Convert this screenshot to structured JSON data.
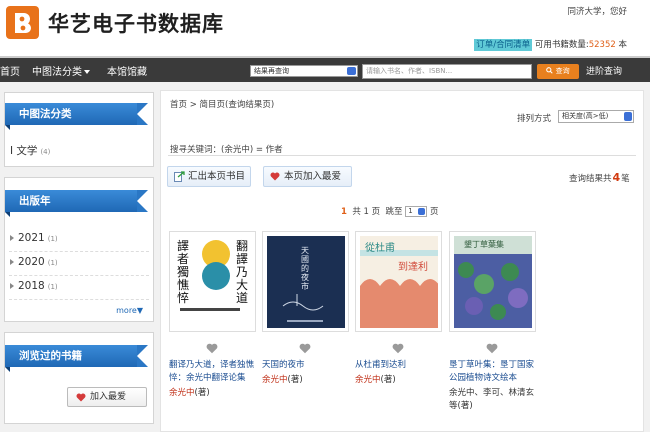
{
  "header": {
    "site_title": "华艺电子书数据库",
    "welcome": "同济大学，您好",
    "order_link": "订单/合同清单",
    "available_label": "可用书籍数量:",
    "available_count": "52352",
    "available_unit": "本"
  },
  "nav": {
    "home": "首页",
    "clc": "中图法分类",
    "collection": "本馆馆藏",
    "scope_value": "结果再查询",
    "search_placeholder": "请输入书名、作者、ISBN...",
    "search_button": "查询",
    "advanced": "进阶查询"
  },
  "sidebar": {
    "clc_title": "中图法分类",
    "clc_items": [
      {
        "label": "I 文学",
        "count": "(4)"
      }
    ],
    "pub_title": "出版年",
    "pub_items": [
      {
        "label": "2021",
        "count": "(1)"
      },
      {
        "label": "2020",
        "count": "(1)"
      },
      {
        "label": "2018",
        "count": "(1)"
      }
    ],
    "more": "more▼",
    "history_title": "浏览过的书籍",
    "add_fav": "加入最爱"
  },
  "main": {
    "breadcrumb": "首页 > 简目页(查询结果页)",
    "sort_label": "排列方式",
    "sort_value": "相关度(高>低)",
    "keyword_line": "搜寻关键词：(余光中) = 作者",
    "export_button": "汇出本页书目",
    "add_page_fav": "本页加入最爱",
    "result_prefix": "查询结果共",
    "result_count": "4",
    "result_suffix": "笔",
    "pager": {
      "current": "1",
      "total_text": "共 1 页",
      "jump_label": "跳至",
      "jump_value": "1",
      "page_unit": "页"
    }
  },
  "books": [
    {
      "title": "翻译乃大道，译者独憔悴：余光中翻译论集",
      "author": "余光中",
      "role": "(著)",
      "cover_text_a": "譯者獨憔悴",
      "cover_text_b": "翻譯乃大道"
    },
    {
      "title": "天国的夜市",
      "author": "余光中",
      "role": "(著)",
      "cover_text_a": "天國的夜市"
    },
    {
      "title": "从杜甫到达利",
      "author": "余光中",
      "role": "(著)",
      "cover_text_a": "從杜甫",
      "cover_text_b": "到達利"
    },
    {
      "title": "垦丁草叶集：垦丁国家公园植物诗文绘本",
      "author": "余光中",
      "role": "、李可、林清玄等(著)",
      "cover_text_a": "墾丁草葉集"
    }
  ],
  "colors": {
    "accent": "#e8801e",
    "nav_bg": "#3a3a3a",
    "ribbon": "#1f68b5",
    "link": "#1a4c90",
    "author": "#c03018"
  }
}
